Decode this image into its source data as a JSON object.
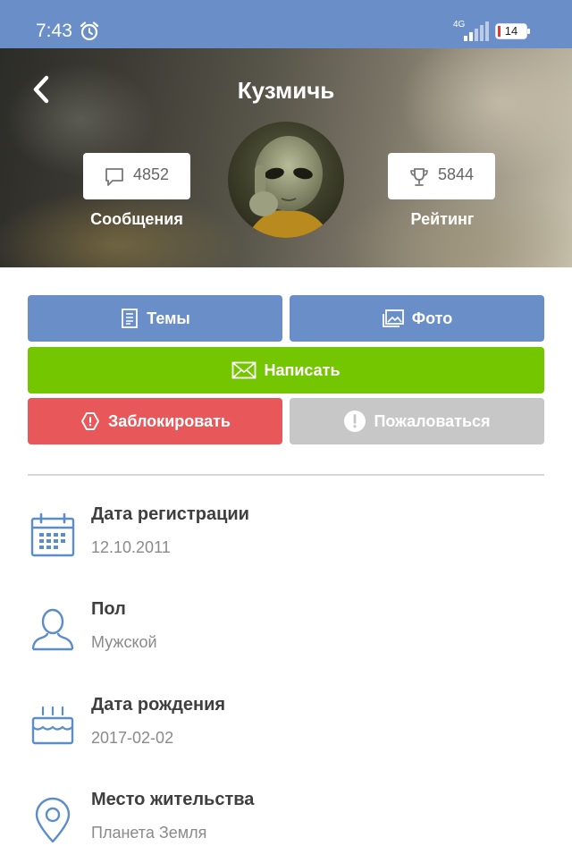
{
  "status_bar": {
    "time": "7:43",
    "network": "4G",
    "network_sub": "4G",
    "battery": "14",
    "icons": [
      "alarm-icon",
      "signal-icon",
      "battery-icon"
    ],
    "battery_level": 0.14
  },
  "header": {
    "title": "Кузмичь",
    "back_icon": "chevron-left-icon",
    "messages": {
      "value": "4852",
      "label": "Сообщения",
      "icon": "chat-bubble-icon"
    },
    "rating": {
      "value": "5844",
      "label": "Рейтинг",
      "icon": "trophy-icon"
    },
    "avatar": "avatar-alien"
  },
  "actions": {
    "topics": {
      "label": "Темы",
      "icon": "document-icon"
    },
    "photo": {
      "label": "Фото",
      "icon": "image-gallery-icon"
    },
    "write": {
      "label": "Написать",
      "icon": "envelope-icon"
    },
    "block": {
      "label": "Заблокировать",
      "icon": "block-icon"
    },
    "report": {
      "label": "Пожаловаться",
      "icon": "exclamation-icon"
    }
  },
  "colors": {
    "primary": "#6a8fc8",
    "green": "#74c600",
    "red": "#e8585b",
    "grey": "#c7c7c7",
    "icon_blue": "#5b8dc9"
  },
  "info": [
    {
      "label": "Дата регистрации",
      "value": "12.10.2011",
      "icon": "calendar-icon"
    },
    {
      "label": "Пол",
      "value": "Мужской",
      "icon": "user-icon"
    },
    {
      "label": "Дата рождения",
      "value": "2017-02-02",
      "icon": "birthday-cake-icon"
    },
    {
      "label": "Место жительства",
      "value": "Планета Земля",
      "icon": "location-pin-icon"
    }
  ]
}
